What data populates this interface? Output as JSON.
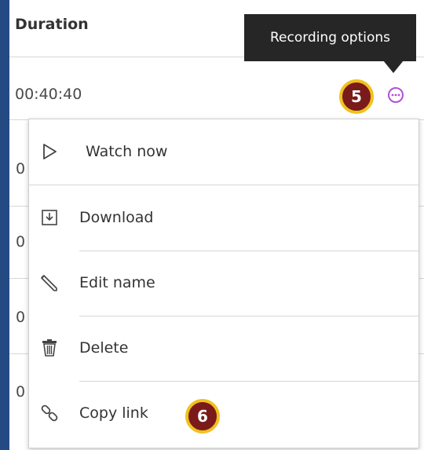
{
  "table": {
    "header_duration": "Duration",
    "row_time": "00:40:40",
    "clipped_row_prefix": "0"
  },
  "tooltip": {
    "text": "Recording options"
  },
  "badges": {
    "options_step": "5",
    "copy_link_step": "6"
  },
  "options_button": {
    "icon": "more-options-icon",
    "color": "#b34fd6"
  },
  "menu": {
    "items": [
      {
        "label": "Watch now",
        "icon": "play-icon"
      },
      {
        "label": "Download",
        "icon": "download-icon"
      },
      {
        "label": "Edit name",
        "icon": "pencil-icon"
      },
      {
        "label": "Delete",
        "icon": "trash-icon"
      },
      {
        "label": "Copy link",
        "icon": "link-icon"
      }
    ]
  },
  "colors": {
    "frame": "#244a84",
    "tooltip_bg": "#262626",
    "badge_fill": "#7a1a1a",
    "badge_ring": "#f0c11f",
    "options_icon": "#b34fd6"
  }
}
